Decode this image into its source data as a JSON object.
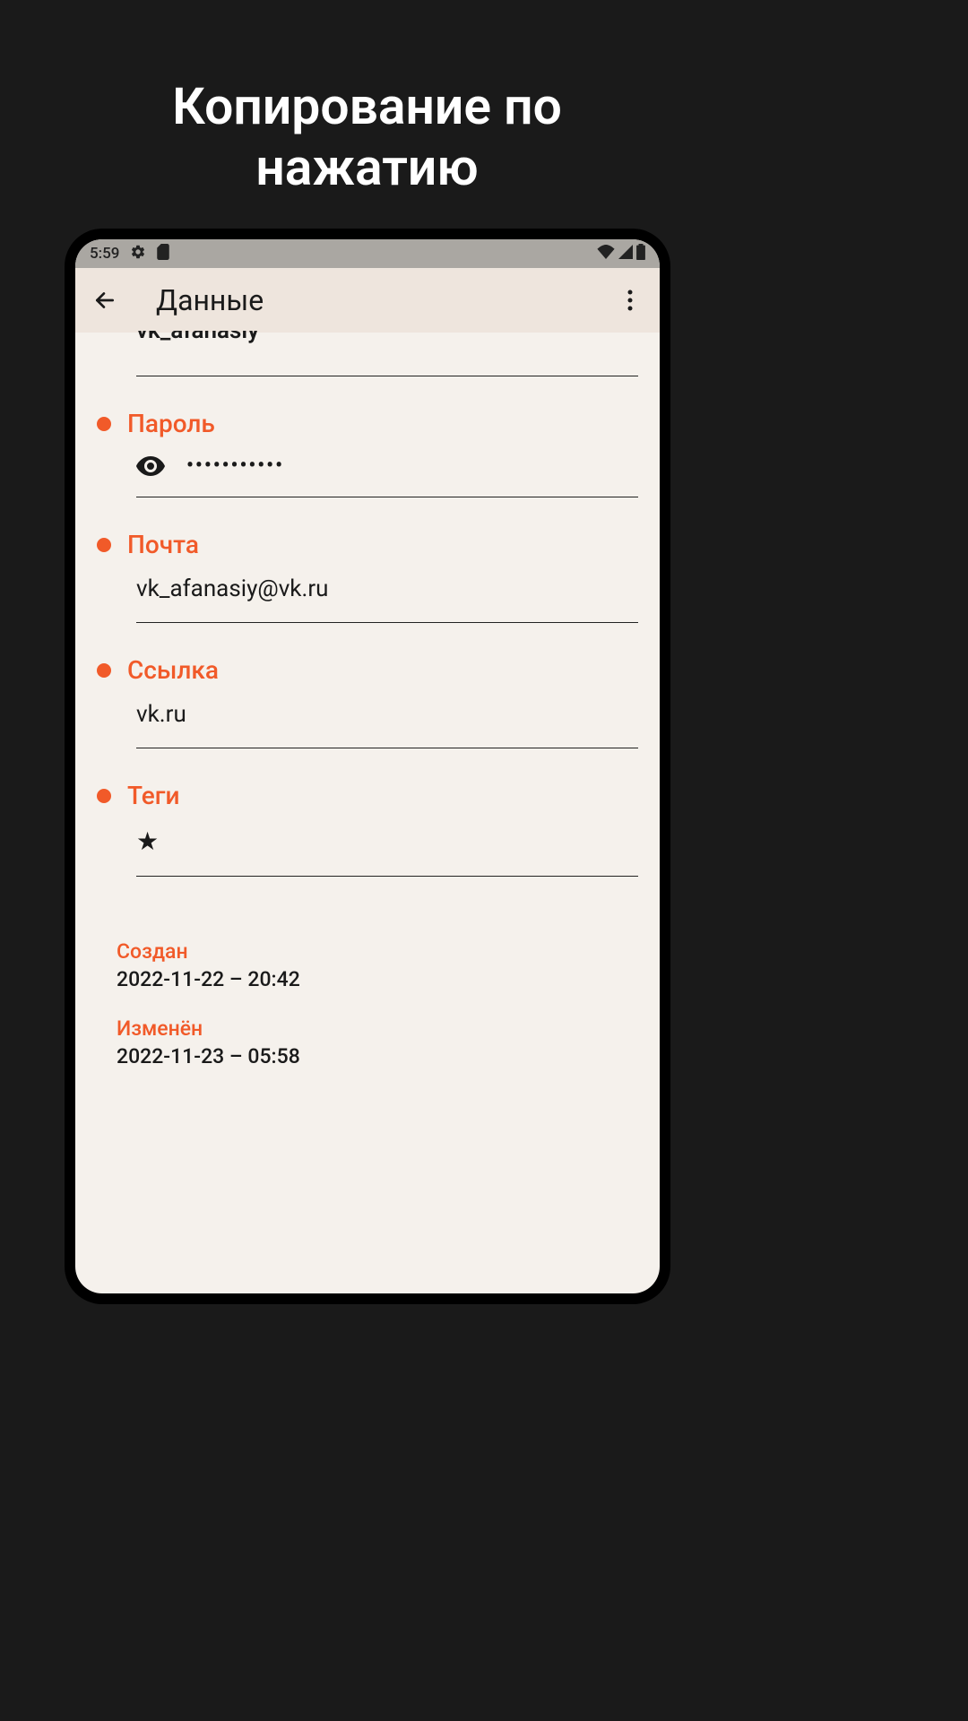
{
  "promo_title_line1": "Копирование по",
  "promo_title_line2": "нажатию",
  "status_bar": {
    "time": "5:59"
  },
  "app_bar": {
    "title": "Данные"
  },
  "partial_field_value": "vk_afanasiy",
  "fields": {
    "password": {
      "label": "Пароль",
      "value": "•••••••••••"
    },
    "email": {
      "label": "Почта",
      "value": "vk_afanasiy@vk.ru"
    },
    "link": {
      "label": "Ссылка",
      "value": "vk.ru"
    },
    "tags": {
      "label": "Теги",
      "value": "★"
    }
  },
  "meta": {
    "created": {
      "label": "Создан",
      "value": "2022-11-22 – 20:42"
    },
    "modified": {
      "label": "Изменён",
      "value": "2022-11-23 – 05:58"
    }
  }
}
